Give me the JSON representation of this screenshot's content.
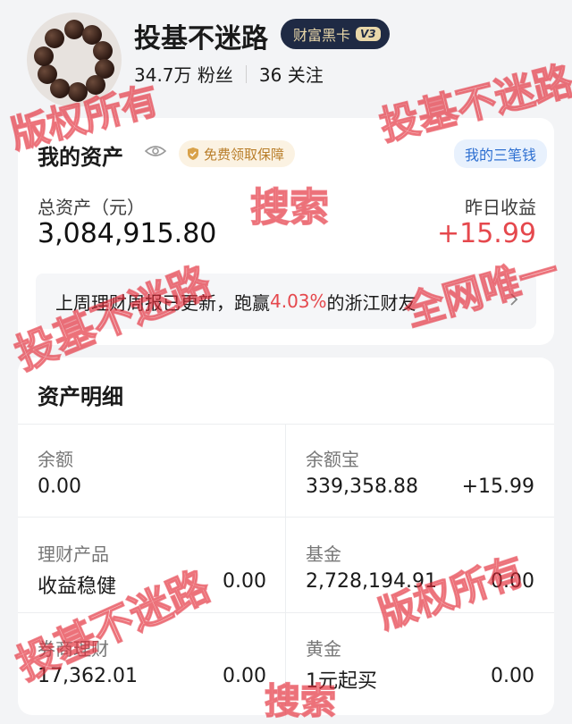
{
  "profile": {
    "nickname": "投基不迷路",
    "badge_label": "财富黑卡",
    "badge_level": "V3",
    "followers": "34.7万 粉丝",
    "following": "36 关注",
    "avatar_icon": "bead-bracelet-avatar"
  },
  "assets": {
    "title": "我的资产",
    "guarantee_label": "免费领取保障",
    "three_pens_label": "我的三笔钱",
    "total_label": "总资产（元）",
    "total_value": "3,084,915.80",
    "yesterday_label": "昨日收益",
    "yesterday_value": "+15.99",
    "report": {
      "prefix": "上周理财周报已更新，跑赢",
      "percent": "4.03%",
      "suffix": "的浙江财友"
    }
  },
  "detail": {
    "title": "资产明细",
    "items": [
      {
        "label": "余额",
        "value": "0.00",
        "extra": ""
      },
      {
        "label": "余额宝",
        "value": "339,358.88",
        "extra": "+15.99"
      },
      {
        "label": "理财产品",
        "value": "收益稳健",
        "extra": "0.00"
      },
      {
        "label": "基金",
        "value": "2,728,194.91",
        "extra": "0.00"
      },
      {
        "label": "券商理财",
        "value": "17,362.01",
        "extra": "0.00"
      },
      {
        "label": "黄金",
        "value": "1元起买",
        "extra": "0.00"
      }
    ]
  },
  "watermarks": [
    "版权所有",
    "投基不迷路",
    "搜索",
    "投基不迷路",
    "全网唯一",
    "投基不迷路",
    "版权所有",
    "搜索",
    "投基不迷"
  ],
  "colors": {
    "accent_red": "#e5484d",
    "badge_bg": "#1f2a44",
    "badge_gold": "#e9d7a9",
    "link_blue": "#2d6fd1"
  }
}
